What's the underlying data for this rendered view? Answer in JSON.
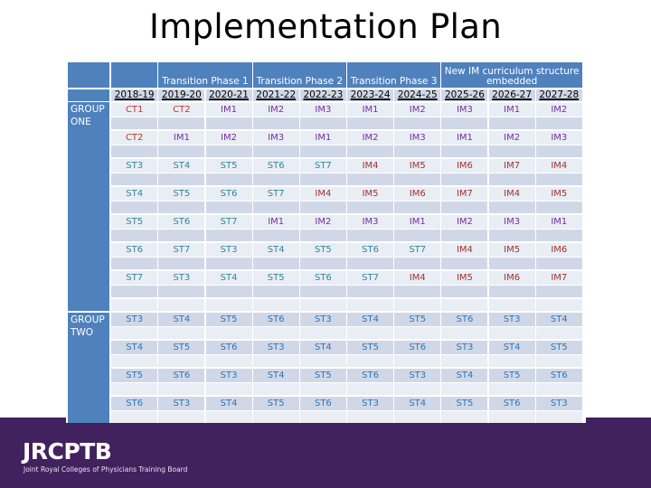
{
  "title": "Implementation Plan",
  "footer": {
    "logo": "JRCPTB",
    "subtitle": "Joint Royal Colleges of Physicians Training Board"
  },
  "colors": {
    "header_blue": "#4f81bd",
    "row_dark": "#d0d8e8",
    "row_light": "#e9edf4",
    "footer_purple": "#42215f",
    "ct_text": "#c0392b",
    "im_text": "#7030a0",
    "im_high_text": "#a0322e",
    "st_group_one_text": "#31859c",
    "st_group_two_text": "#2e75b6"
  },
  "table": {
    "phase_headers": [
      {
        "label": "",
        "span": 1
      },
      {
        "label": "Transition Phase 1",
        "span": 2
      },
      {
        "label": "Transition Phase 2",
        "span": 2
      },
      {
        "label": "Transition Phase 3",
        "span": 2
      },
      {
        "label": "New IM curriculum structure embedded",
        "span": 3
      }
    ],
    "years": [
      "2018-19",
      "2019-20",
      "2020-21",
      "2021-22",
      "2022-23",
      "2023-24",
      "2024-25",
      "2025-26",
      "2026-27",
      "2027-28"
    ],
    "groups": [
      {
        "label": "GROUP ONE",
        "rows": [
          [
            "CT1",
            "CT2",
            "IM1",
            "IM2",
            "IM3",
            "IM1",
            "IM2",
            "IM3",
            "IM1",
            "IM2"
          ],
          [
            "CT2",
            "IM1",
            "IM2",
            "IM3",
            "IM1",
            "IM2",
            "IM3",
            "IM1",
            "IM2",
            "IM3"
          ],
          [
            "ST3",
            "ST4",
            "ST5",
            "ST6",
            "ST7",
            "IM4",
            "IM5",
            "IM6",
            "IM7",
            "IM4"
          ],
          [
            "ST4",
            "ST5",
            "ST6",
            "ST7",
            "IM4",
            "IM5",
            "IM6",
            "IM7",
            "IM4",
            "IM5"
          ],
          [
            "ST5",
            "ST6",
            "ST7",
            "IM1",
            "IM2",
            "IM3",
            "IM1",
            "IM2",
            "IM3",
            "IM1"
          ],
          [
            "ST6",
            "ST7",
            "ST3",
            "ST4",
            "ST5",
            "ST6",
            "ST7",
            "IM4",
            "IM5",
            "IM6"
          ],
          [
            "ST7",
            "ST3",
            "ST4",
            "ST5",
            "ST6",
            "ST7",
            "IM4",
            "IM5",
            "IM6",
            "IM7"
          ]
        ]
      },
      {
        "label": "GROUP TWO",
        "rows": [
          [
            "ST3",
            "ST4",
            "ST5",
            "ST6",
            "ST3",
            "ST4",
            "ST5",
            "ST6",
            "ST3",
            "ST4"
          ],
          [
            "ST4",
            "ST5",
            "ST6",
            "ST3",
            "ST4",
            "ST5",
            "ST6",
            "ST3",
            "ST4",
            "ST5"
          ],
          [
            "ST5",
            "ST6",
            "ST3",
            "ST4",
            "ST5",
            "ST6",
            "ST3",
            "ST4",
            "ST5",
            "ST6"
          ],
          [
            "ST6",
            "ST3",
            "ST4",
            "ST5",
            "ST6",
            "ST3",
            "ST4",
            "ST5",
            "ST6",
            "ST3"
          ]
        ]
      }
    ]
  }
}
